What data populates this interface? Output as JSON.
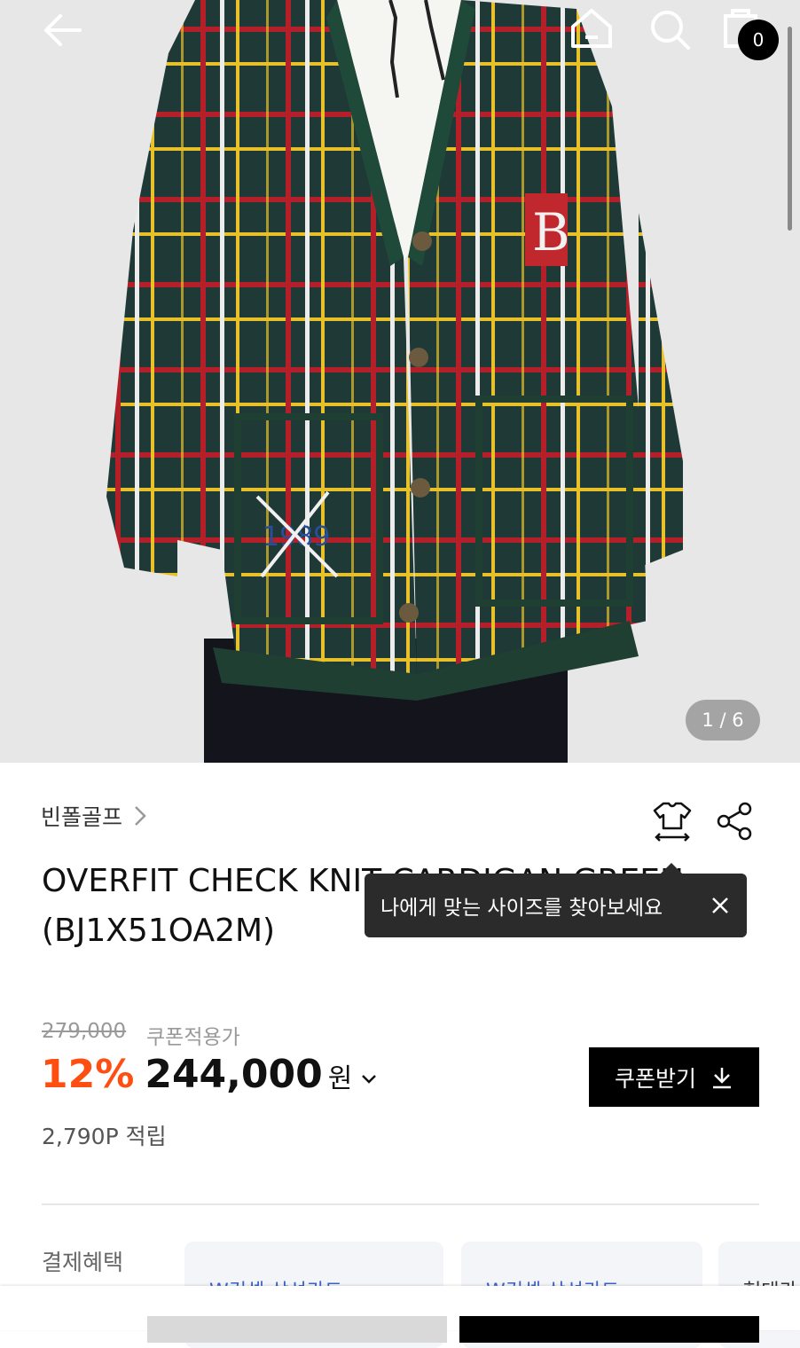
{
  "header": {
    "cart_count": "0",
    "image_counter": "1 / 6"
  },
  "product": {
    "brand": "빈폴골프",
    "title_line1": "OVERFIT CHECK KNIT CARDIGAN GREEN",
    "title_line2": "(BJ1X51OA2M)",
    "tooltip": "나에게 맞는 사이즈를 찾아보세요",
    "original_price": "279,000",
    "coupon_price_label": "쿠폰적용가",
    "discount": "12%",
    "price": "244,000",
    "currency": "원",
    "coupon_button": "쿠폰받기",
    "points": "2,790P 적립"
  },
  "benefits": {
    "label": "결제혜택",
    "cards": [
      "W컨셉 삼성카드",
      "W컨셉 삼성카드",
      "현대카드"
    ]
  },
  "colors": {
    "accent_discount": "#ff4e12",
    "cardigan_green": "#1f3f32",
    "check_red": "#b3202a",
    "check_yellow": "#e8c12a"
  }
}
